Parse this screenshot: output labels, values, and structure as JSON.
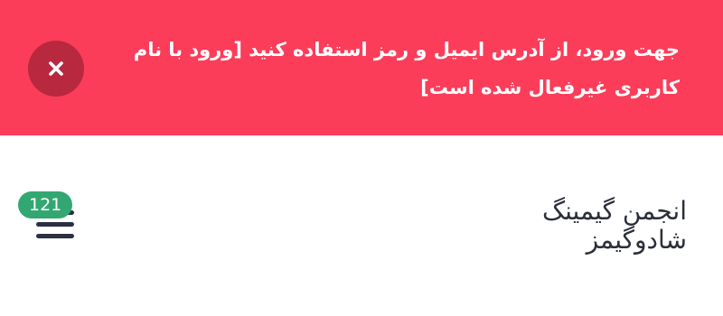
{
  "alert": {
    "message": "جهت ورود، از آدرس ایمیل و رمز استفاده کنید [ورود با نام کاربری غیرفعال شده است]",
    "close_icon": "close-icon",
    "background_color": "#fb3d5a",
    "close_button_color": "#b8283e"
  },
  "header": {
    "site_title_line1": "انجمن گیمینگ",
    "site_title_line2": "شادوگیمز",
    "menu_icon": "hamburger-menu-icon",
    "notification_count": "121",
    "badge_color": "#33a772"
  }
}
